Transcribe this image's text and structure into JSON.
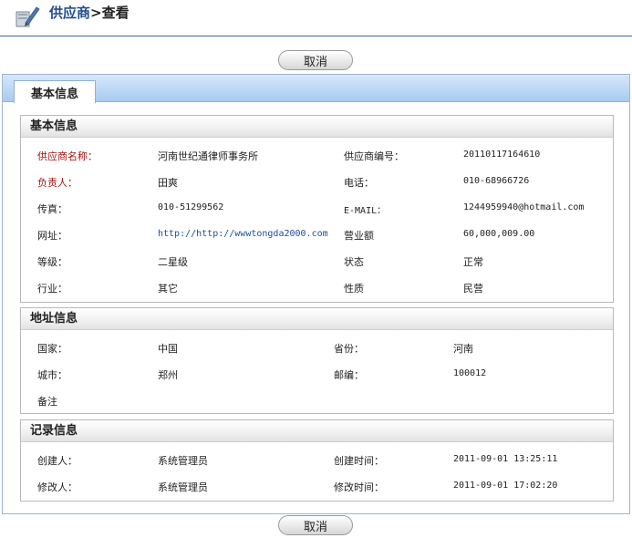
{
  "header": {
    "title": "供应商",
    "separator": ">",
    "subtitle": "查看"
  },
  "buttons": {
    "cancel_top": "取消",
    "cancel_bottom": "取消"
  },
  "tab": {
    "label": "基本信息"
  },
  "basic": {
    "heading": "基本信息",
    "fields": {
      "supplier_name_label": "供应商名称：",
      "supplier_name_value": "河南世纪通律师事务所",
      "supplier_no_label": "供应商编号：",
      "supplier_no_value": "20110117164610",
      "contact_label": "负责人：",
      "contact_value": "田爽",
      "phone_label": "电话：",
      "phone_value": "010-68966726",
      "fax_label": "传真：",
      "fax_value": "010-51299562",
      "email_label": "E-MAIL：",
      "email_value": "1244959940@hotmail.com",
      "website_label": "网址：",
      "website_value": "http://http://wwwtongda2000.com",
      "turnover_label": "营业额",
      "turnover_value": "60,000,009.00",
      "grade_label": "等级：",
      "grade_value": "二星级",
      "status_label": "状态",
      "status_value": "正常",
      "industry_label": "行业：",
      "industry_value": "其它",
      "nature_label": "性质",
      "nature_value": "民营"
    }
  },
  "address": {
    "heading": "地址信息",
    "fields": {
      "country_label": "国家：",
      "country_value": "中国",
      "province_label": "省份：",
      "province_value": "河南",
      "city_label": "城市：",
      "city_value": "郑州",
      "zip_label": "邮编：",
      "zip_value": "100012",
      "remark_label": "备注"
    }
  },
  "record": {
    "heading": "记录信息",
    "fields": {
      "creator_label": "创建人：",
      "creator_value": "系统管理员",
      "created_label": "创建时间：",
      "created_value": "2011-09-01 13:25:11",
      "modifier_label": "修改人：",
      "modifier_value": "系统管理员",
      "modified_label": "修改时间：",
      "modified_value": "2011-09-01 17:02:20"
    }
  },
  "colors": {
    "required": "#a01414",
    "link": "#1a4e9c",
    "title": "#214f8c",
    "tabbar": "#a9cbef"
  },
  "icons": {
    "header": "pencil-book-icon"
  }
}
